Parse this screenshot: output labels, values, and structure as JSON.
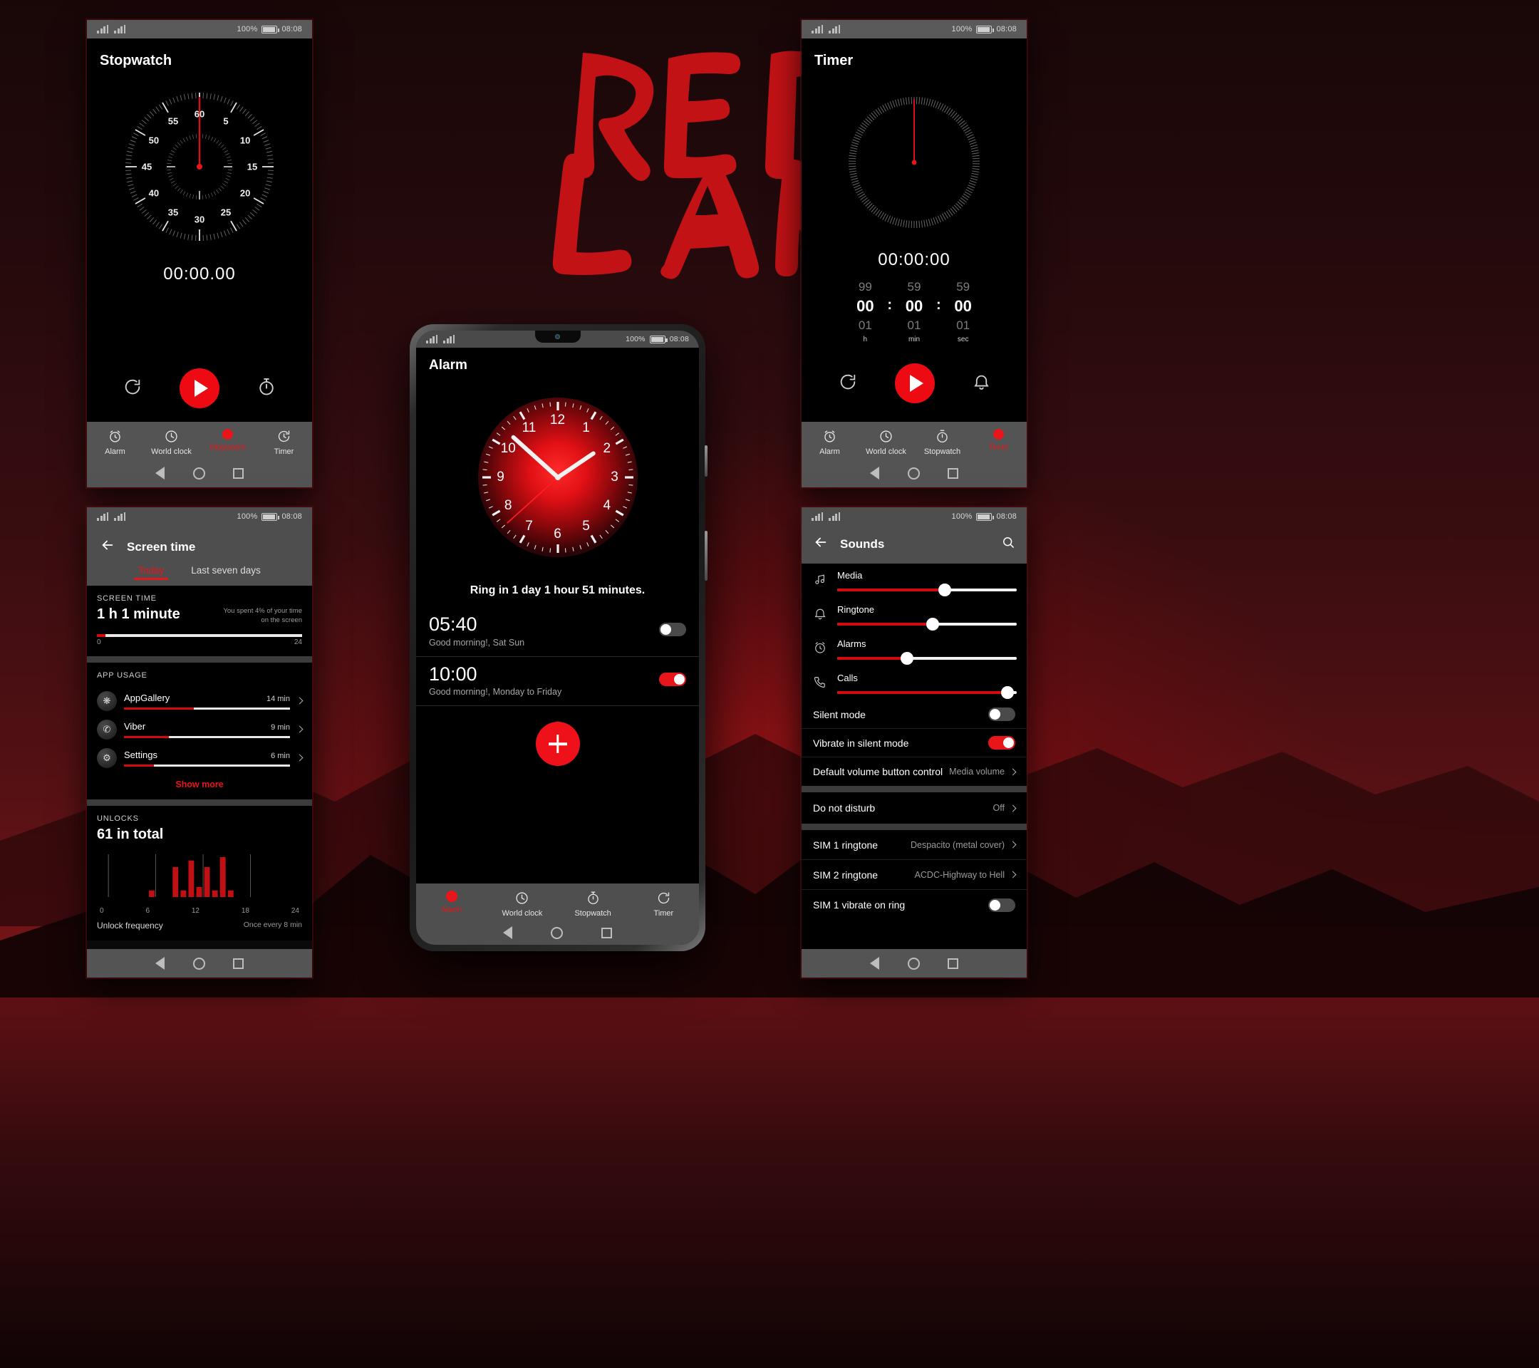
{
  "wallpaper": {
    "title_line1": "RED",
    "title_line2": "LAKE",
    "accent": "#c21216"
  },
  "theme": {
    "accent_red": "#e8151b",
    "fab_red": "#ee0a13",
    "bar_gray": "#545454"
  },
  "status_bar": {
    "battery_percent": "100%",
    "time": "08:08"
  },
  "stopwatch_panel": {
    "title": "Stopwatch",
    "elapsed": "00:00.00",
    "dial_labels": [
      "60",
      "5",
      "10",
      "15",
      "20",
      "25",
      "30",
      "35",
      "40",
      "45",
      "50",
      "55"
    ],
    "controls": {
      "reset": "reset-icon",
      "start": "play-icon",
      "lap": "lap-icon"
    },
    "nav": [
      {
        "label": "Alarm",
        "icon": "alarm-clock-icon",
        "active": false
      },
      {
        "label": "World clock",
        "icon": "clock-icon",
        "active": false
      },
      {
        "label": "Stopwatch",
        "icon": "stopwatch-icon",
        "active": true
      },
      {
        "label": "Timer",
        "icon": "timer-icon",
        "active": false
      }
    ]
  },
  "timer_panel": {
    "title": "Timer",
    "display": "00:00:00",
    "picker": {
      "columns": [
        {
          "above": "99",
          "value": "00",
          "below": "01",
          "unit": "h"
        },
        {
          "above": "59",
          "value": "00",
          "below": "01",
          "unit": "min"
        },
        {
          "above": "59",
          "value": "00",
          "below": "01",
          "unit": "sec"
        }
      ],
      "separator": ":"
    },
    "controls": {
      "reset": "reset-icon",
      "start": "play-icon",
      "ring": "bell-icon"
    },
    "nav": [
      {
        "label": "Alarm",
        "icon": "alarm-clock-icon",
        "active": false
      },
      {
        "label": "World clock",
        "icon": "clock-icon",
        "active": false
      },
      {
        "label": "Stopwatch",
        "icon": "stopwatch-icon",
        "active": false
      },
      {
        "label": "Timer",
        "icon": "timer-icon",
        "active": true
      }
    ]
  },
  "alarm_phone": {
    "title": "Alarm",
    "clock_numbers": [
      "12",
      "1",
      "2",
      "3",
      "4",
      "5",
      "6",
      "7",
      "8",
      "9",
      "10",
      "11"
    ],
    "clock_time": {
      "hour": 1,
      "minute": 52,
      "second": 38
    },
    "ring_text": "Ring in 1 day 1 hour 51 minutes.",
    "alarms": [
      {
        "time": "05:40",
        "desc": "Good morning!, Sat Sun",
        "enabled": false
      },
      {
        "time": "10:00",
        "desc": "Good morning!, Monday to Friday",
        "enabled": true
      }
    ],
    "add_button": "add-alarm-icon",
    "nav": [
      {
        "label": "Alarm",
        "icon": "alarm-clock-icon",
        "active": true
      },
      {
        "label": "World clock",
        "icon": "clock-icon",
        "active": false
      },
      {
        "label": "Stopwatch",
        "icon": "stopwatch-icon",
        "active": false
      },
      {
        "label": "Timer",
        "icon": "timer-icon",
        "active": false
      }
    ]
  },
  "screen_time_panel": {
    "back": "back-arrow-icon",
    "title": "Screen time",
    "tabs": [
      {
        "label": "Today",
        "active": true
      },
      {
        "label": "Last seven days",
        "active": false
      }
    ],
    "screen_time": {
      "section_label": "SCREEN TIME",
      "value": "1 h 1 minute",
      "note_line1": "You spent 4% of your time",
      "note_line2": "on the screen",
      "progress_percent": 4,
      "axis_min": "0",
      "axis_max": "24"
    },
    "app_usage": {
      "section_label": "APP USAGE",
      "apps": [
        {
          "name": "AppGallery",
          "duration": "14 min",
          "bar_percent": 42,
          "icon": "appgallery-icon"
        },
        {
          "name": "Viber",
          "duration": "9 min",
          "bar_percent": 27,
          "icon": "viber-icon"
        },
        {
          "name": "Settings",
          "duration": "6 min",
          "bar_percent": 18,
          "icon": "settings-gear-icon"
        }
      ],
      "show_more": "Show more"
    },
    "unlocks": {
      "section_label": "UNLOCKS",
      "value": "61 in total",
      "footer_left": "Unlock frequency",
      "footer_right": "Once every 8 min",
      "axis_labels": [
        "0",
        "6",
        "12",
        "18",
        "24"
      ],
      "hours": [
        0,
        1,
        2,
        3,
        4,
        5,
        6,
        7,
        8,
        9,
        10,
        11,
        12,
        13,
        14,
        15,
        16,
        17,
        18,
        19,
        20,
        21,
        22,
        23
      ],
      "values": [
        0,
        0,
        0,
        0,
        0,
        2,
        0,
        0,
        9,
        2,
        11,
        3,
        9,
        2,
        12,
        2,
        0,
        0,
        0,
        0,
        0,
        0,
        0,
        0
      ]
    }
  },
  "sounds_panel": {
    "back": "back-arrow-icon",
    "title": "Sounds",
    "search": "search-icon",
    "sliders": [
      {
        "label": "Media",
        "icon": "music-note-icon",
        "percent": 60
      },
      {
        "label": "Ringtone",
        "icon": "bell-icon",
        "percent": 53
      },
      {
        "label": "Alarms",
        "icon": "alarm-clock-icon",
        "percent": 39
      },
      {
        "label": "Calls",
        "icon": "phone-icon",
        "percent": 95
      }
    ],
    "toggles": [
      {
        "label": "Silent mode",
        "on": false
      },
      {
        "label": "Vibrate in silent mode",
        "on": true
      }
    ],
    "links": [
      {
        "label": "Default volume button control",
        "value": "Media volume"
      }
    ],
    "dnd": {
      "label": "Do not disturb",
      "value": "Off"
    },
    "ringtones": [
      {
        "label": "SIM 1 ringtone",
        "value": "Despacito (metal cover)"
      },
      {
        "label": "SIM 2 ringtone",
        "value": "ACDC-Highway to Hell"
      }
    ],
    "vibrate_row": {
      "label": "SIM 1 vibrate on ring",
      "on": false
    }
  }
}
